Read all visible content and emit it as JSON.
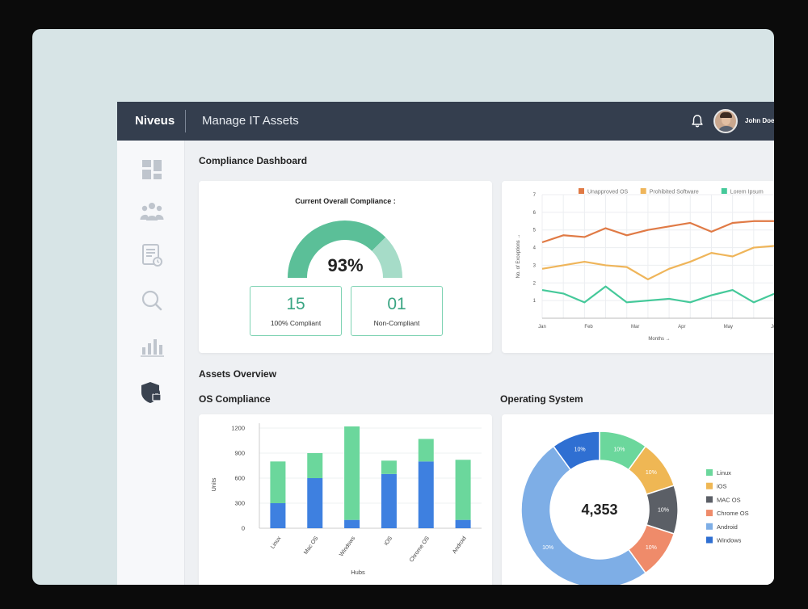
{
  "topbar": {
    "brand": "Niveus",
    "app_title": "Manage IT Assets",
    "username": "John Doe"
  },
  "sidebar": {
    "icons": [
      "dashboard-icon",
      "users-icon",
      "document-clock-icon",
      "search-icon",
      "bar-chart-icon",
      "shield-lock-icon"
    ]
  },
  "compliance": {
    "heading": "Compliance Dashboard",
    "gauge_title": "Current Overall Compliance :",
    "gauge_percent": 93,
    "gauge_label": "93%",
    "stats": [
      {
        "value": "15",
        "label": "100% Compliant"
      },
      {
        "value": "01",
        "label": "Non-Compliant"
      }
    ]
  },
  "assets": {
    "heading": "Assets Overview",
    "os_compliance_heading": "OS Compliance",
    "operating_system_heading": "Operating System",
    "donut_total": "4,353"
  },
  "colors": {
    "teal": "#5bbf98",
    "orange": "#e07a45",
    "yellow": "#efb55a",
    "green_line": "#45c99a",
    "bar_green": "#6bd79c",
    "bar_blue": "#3e80e0",
    "donut_green": "#6bd79c",
    "donut_yellow": "#efb754",
    "donut_gray": "#5b5f66",
    "donut_salmon": "#ef8b6a",
    "donut_lightblue": "#7eaee6",
    "donut_blue": "#2f6fd2"
  },
  "chart_data": [
    {
      "type": "line",
      "title": "",
      "xlabel": "Months →",
      "ylabel": "No. of Exceptions →",
      "categories": [
        "Jan",
        "",
        "Feb",
        "",
        "Mar",
        "",
        "Apr",
        "",
        "May",
        "",
        "Jun"
      ],
      "x_tick_labels": [
        "Jan",
        "Feb",
        "Mar",
        "Apr",
        "May",
        "Jun"
      ],
      "ylim": [
        0,
        7
      ],
      "y_ticks": [
        1,
        2,
        3,
        4,
        5,
        6,
        7
      ],
      "grid": true,
      "legend": "top",
      "series": [
        {
          "name": "Unapproved OS",
          "color": "#e07a45",
          "values": [
            4.3,
            4.7,
            4.6,
            5.1,
            4.7,
            5.0,
            5.2,
            5.4,
            4.9,
            5.4,
            5.5,
            5.5
          ]
        },
        {
          "name": "Prohibited Software",
          "color": "#efb55a",
          "values": [
            2.8,
            3.0,
            3.2,
            3.0,
            2.9,
            2.2,
            2.8,
            3.2,
            3.7,
            3.5,
            4.0,
            4.1
          ]
        },
        {
          "name": "Lorem Ipsum",
          "color": "#45c99a",
          "values": [
            1.6,
            1.4,
            0.9,
            1.8,
            0.9,
            1.0,
            1.1,
            0.9,
            1.3,
            1.6,
            0.9,
            1.4
          ]
        }
      ]
    },
    {
      "type": "bar",
      "stacked": true,
      "title": "",
      "xlabel": "Hubs",
      "ylabel": "Units",
      "categories": [
        "Linux",
        "Mac OS",
        "Windows",
        "iOS",
        "Chrome OS",
        "Android"
      ],
      "ylim": [
        0,
        1200
      ],
      "y_ticks": [
        0,
        300,
        600,
        900,
        1200
      ],
      "grid": true,
      "series": [
        {
          "name": "",
          "color": "#3e80e0",
          "values": [
            300,
            600,
            100,
            650,
            800,
            100
          ]
        },
        {
          "name": "",
          "color": "#6bd79c",
          "values": [
            500,
            300,
            1120,
            160,
            270,
            720
          ]
        }
      ]
    },
    {
      "type": "pie",
      "donut": true,
      "title": "",
      "center_label": "4,353",
      "legend": "right",
      "slices": [
        {
          "name": "Linux",
          "value": 10,
          "label": "10%",
          "color": "#6bd79c"
        },
        {
          "name": "iOS",
          "value": 10,
          "label": "10%",
          "color": "#efb754"
        },
        {
          "name": "MAC OS",
          "value": 10,
          "label": "10%",
          "color": "#5b5f66"
        },
        {
          "name": "Chrome OS",
          "value": 10,
          "label": "10%",
          "color": "#ef8b6a"
        },
        {
          "name": "Android",
          "value": 50,
          "label": "10%",
          "color": "#7eaee6"
        },
        {
          "name": "Windows",
          "value": 10,
          "label": "10%",
          "color": "#2f6fd2"
        }
      ]
    }
  ]
}
